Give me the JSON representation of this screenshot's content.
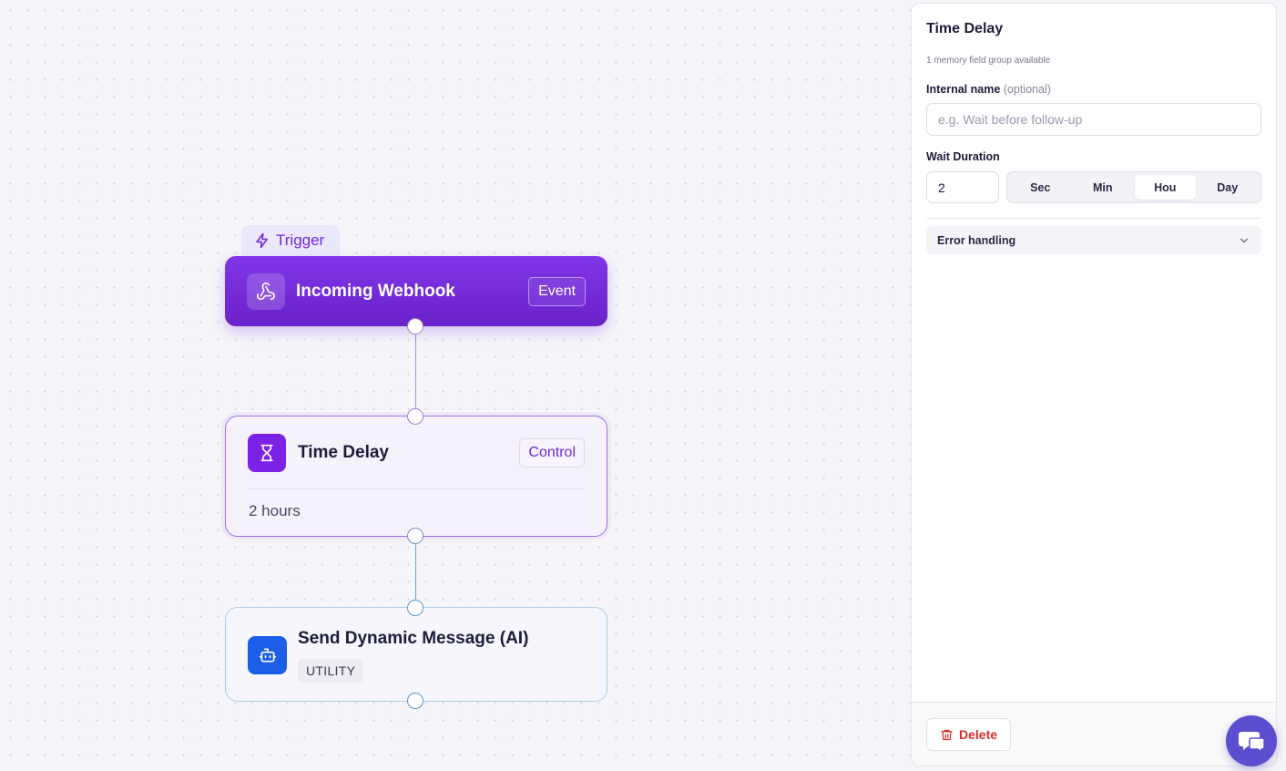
{
  "flow": {
    "trigger_tag": "Trigger",
    "nodes": [
      {
        "title": "Incoming Webhook",
        "badge": "Event",
        "icon": "webhook-icon"
      },
      {
        "title": "Time Delay",
        "badge": "Control",
        "summary": "2 hours",
        "icon": "hourglass-icon"
      },
      {
        "title": "Send Dynamic Message (AI)",
        "badge": "UTILITY",
        "icon": "bot-icon"
      }
    ]
  },
  "panel": {
    "title": "Time Delay",
    "subtitle": "1 memory field group available",
    "internal_name": {
      "label": "Internal name",
      "optional": "(optional)",
      "placeholder": "e.g. Wait before follow-up",
      "value": ""
    },
    "wait_duration": {
      "label": "Wait Duration",
      "value": "2",
      "units": [
        "Sec",
        "Min",
        "Hou",
        "Day"
      ],
      "selected_unit": "Hou"
    },
    "error_handling": {
      "label": "Error handling"
    },
    "delete_label": "Delete"
  },
  "colors": {
    "trigger_purple": "#6d28d9",
    "ai_blue": "#1d5ee8",
    "delete_red": "#d92d2d",
    "fab": "#5b4fd0"
  }
}
